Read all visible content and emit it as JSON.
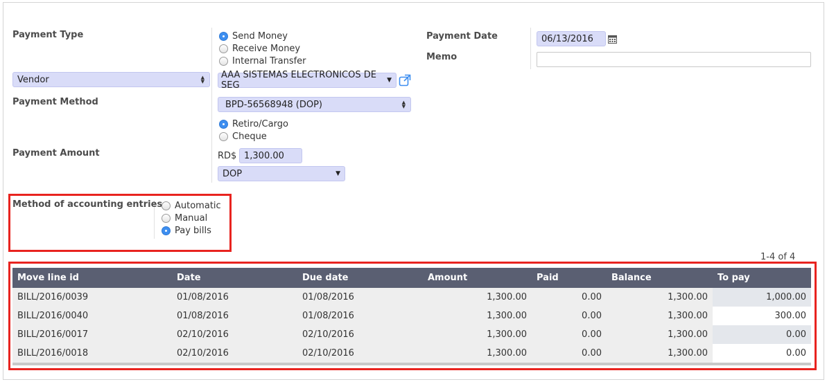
{
  "form": {
    "payment_type_label": "Payment Type",
    "payment_type_options": [
      {
        "label": "Send Money",
        "selected": true
      },
      {
        "label": "Receive Money",
        "selected": false
      },
      {
        "label": "Internal Transfer",
        "selected": false
      }
    ],
    "partner_type_value": "Vendor",
    "partner_value": "AAA SISTEMAS ELECTRONICOS DE SEG",
    "payment_method_label": "Payment Method",
    "journal_value": "BPD-56568948 (DOP)",
    "payment_method_options": [
      {
        "label": "Retiro/Cargo",
        "selected": true
      },
      {
        "label": "Cheque",
        "selected": false
      }
    ],
    "payment_amount_label": "Payment Amount",
    "currency_symbol": "RD$",
    "amount_value": "1,300.00",
    "currency_value": "DOP",
    "payment_date_label": "Payment Date",
    "payment_date_value": "06/13/2016",
    "memo_label": "Memo",
    "memo_value": "",
    "accounting_method_label": "Method of accounting entries",
    "accounting_method_options": [
      {
        "label": "Automatic",
        "selected": false
      },
      {
        "label": "Manual",
        "selected": false
      },
      {
        "label": "Pay bills",
        "selected": true
      }
    ]
  },
  "table": {
    "pager": "1-4 of 4",
    "columns": [
      "Move line id",
      "Date",
      "Due date",
      "Amount",
      "Paid",
      "Balance",
      "To pay"
    ],
    "rows": [
      [
        "BILL/2016/0039",
        "01/08/2016",
        "01/08/2016",
        "1,300.00",
        "0.00",
        "1,300.00",
        "1,000.00"
      ],
      [
        "BILL/2016/0040",
        "01/08/2016",
        "01/08/2016",
        "1,300.00",
        "0.00",
        "1,300.00",
        "300.00"
      ],
      [
        "BILL/2016/0017",
        "02/10/2016",
        "02/10/2016",
        "1,300.00",
        "0.00",
        "1,300.00",
        "0.00"
      ],
      [
        "BILL/2016/0018",
        "02/10/2016",
        "02/10/2016",
        "1,300.00",
        "0.00",
        "1,300.00",
        "0.00"
      ]
    ]
  },
  "colors": {
    "highlight_red": "#e8231f",
    "table_header": "#5a5f72",
    "field_bg": "#d9dcf8",
    "radio_selected": "#3d8ef0"
  }
}
